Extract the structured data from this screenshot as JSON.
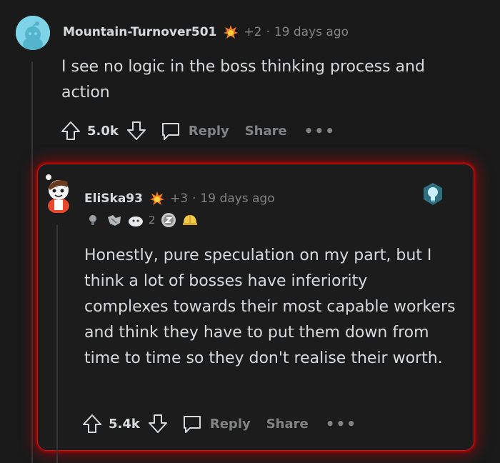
{
  "comment1": {
    "username": "Mountain-Turnover501",
    "flair_icon": "flame-award-icon",
    "score_tag": "+2",
    "time": "19 days ago",
    "body": "I see no logic in the boss thinking process and action",
    "votes": "5.0k",
    "reply_label": "Reply",
    "share_label": "Share",
    "more_label": "•••"
  },
  "comment2": {
    "username": "EliSka93",
    "flair_icon": "flame-award-icon",
    "score_tag": "+3",
    "time": "19 days ago",
    "awards_count": "2",
    "body": "Honestly, pure speculation on my part, but I think a lot of bosses have inferiority complexes towards their most capable workers and think they have to put them down from time to time so they don't realise their worth.",
    "votes": "5.4k",
    "reply_label": "Reply",
    "share_label": "Share",
    "more_label": "•••"
  },
  "colors": {
    "background": "#1a1a1b",
    "text": "#d7dadc",
    "muted": "#818384",
    "highlight_glow": "#d70000"
  }
}
